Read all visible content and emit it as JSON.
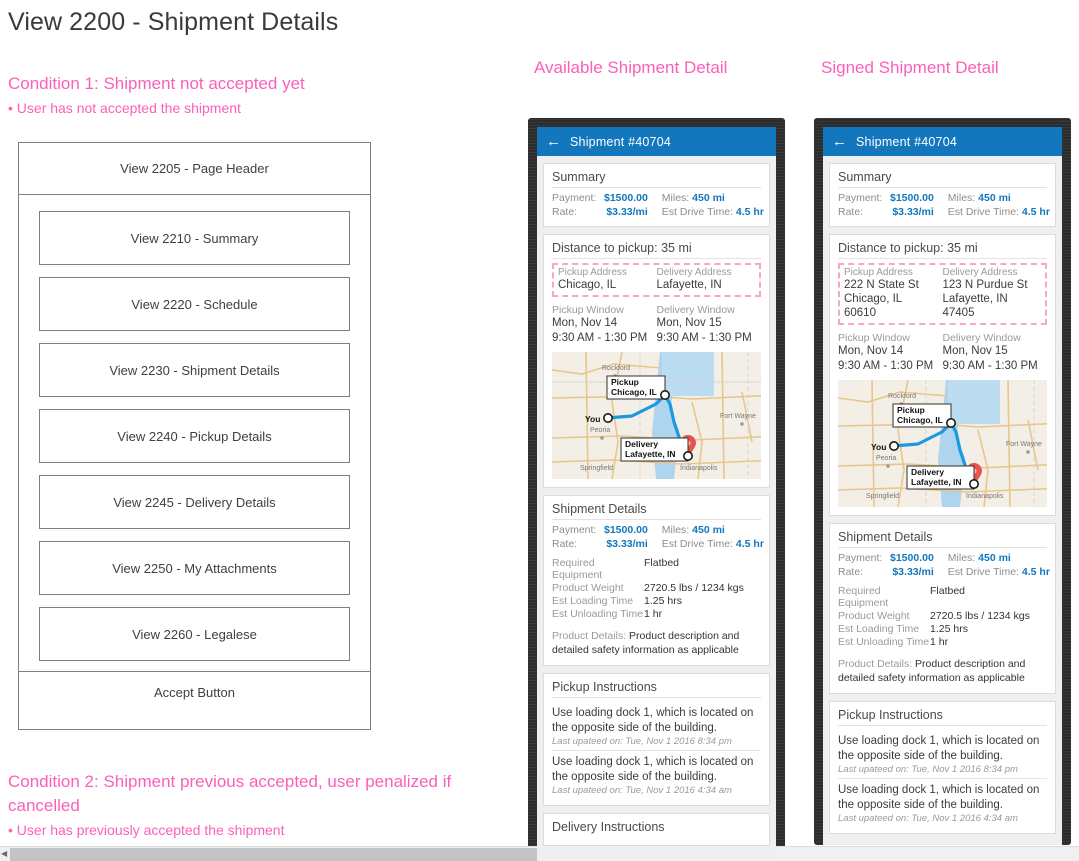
{
  "page": {
    "title": "View 2200 - Shipment Details"
  },
  "conditions": [
    {
      "heading": "Condition 1: Shipment not accepted yet",
      "bullet": "• User has not accepted the shipment"
    },
    {
      "heading": "Condition 2: Shipment previous accepted, user penalized if cancelled",
      "bullet": "• User has previously accepted the shipment"
    }
  ],
  "wireframe": {
    "header_band": "View 2205 - Page Header",
    "items": [
      "View 2210 - Summary",
      "View 2220 - Schedule",
      "View 2230 - Shipment Details",
      "View 2240 - Pickup Details",
      "View 2245 - Delivery Details",
      "View 2250 - My Attachments",
      "View 2260 - Legalese"
    ],
    "footer_band": "Accept Button"
  },
  "columns": {
    "available": {
      "title": "Available Shipment Detail"
    },
    "signed": {
      "title": "Signed Shipment Detail"
    }
  },
  "appbar": {
    "back_icon": "←",
    "title": "Shipment #40704"
  },
  "summary": {
    "card_title": "Summary",
    "payment_label": "Payment:",
    "payment_value": "$1500.00",
    "rate_label": "Rate:",
    "rate_value": "$3.33/mi",
    "miles_label": "Miles:",
    "miles_value": "450 mi",
    "drive_label": "Est Drive Time:",
    "drive_value": "4.5 hr"
  },
  "schedule": {
    "card_title": "Distance to pickup: 35 mi",
    "pickup_addr_label": "Pickup Address",
    "delivery_addr_label": "Delivery Address",
    "pickup_addr_short": "Chicago, IL",
    "delivery_addr_short": "Lafayette, IN",
    "pickup_addr_full_1": "222 N State St",
    "pickup_addr_full_2": "Chicago, IL",
    "pickup_addr_full_3": "60610",
    "delivery_addr_full_1": "123 N Purdue St",
    "delivery_addr_full_2": "Lafayette, IN",
    "delivery_addr_full_3": "47405",
    "pickup_window_label": "Pickup Window",
    "delivery_window_label": "Delivery Window",
    "pickup_window_date": "Mon, Nov 14",
    "pickup_window_time": "9:30 AM - 1:30 PM",
    "delivery_window_date": "Mon, Nov 15",
    "delivery_window_time": "9:30 AM - 1:30 PM"
  },
  "map": {
    "pickup_label_1": "Pickup",
    "pickup_label_2": "Chicago, IL",
    "delivery_label_1": "Delivery",
    "delivery_label_2": "Lafayette, IN",
    "you_label": "You",
    "cities": [
      "Rockford",
      "Peoria",
      "Springfield",
      "Indianapolis",
      "Fort Wayne"
    ]
  },
  "shipment_details": {
    "card_title": "Shipment Details",
    "rows": [
      {
        "label": "Required Equipment",
        "value": "Flatbed"
      },
      {
        "label": "Product Weight",
        "value": "2720.5 lbs / 1234 kgs"
      },
      {
        "label": "Est Loading Time",
        "value": "1.25 hrs"
      },
      {
        "label": "Est Unloading Time",
        "value": "1 hr"
      }
    ],
    "product_details_label": "Product Details:",
    "product_details_value": "Product description and detailed safety information as applicable"
  },
  "pickup_instructions": {
    "card_title": "Pickup Instructions",
    "items": [
      {
        "text": "Use loading dock 1, which is located on the opposite side of the building.",
        "meta": "Last upateed on: Tue, Nov 1 2016 8:34 pm"
      },
      {
        "text": "Use loading dock 1, which is located on the opposite side of the building.",
        "meta": "Last upateed on: Tue,  Nov 1 2016 4:34 am"
      }
    ]
  },
  "delivery_instructions": {
    "card_title": "Delivery Instructions"
  },
  "colors": {
    "accent_pink": "#fb5fb9",
    "appbar_blue": "#1277bc",
    "value_blue": "#1277bc",
    "phone_frame": "#2c2c2c"
  }
}
